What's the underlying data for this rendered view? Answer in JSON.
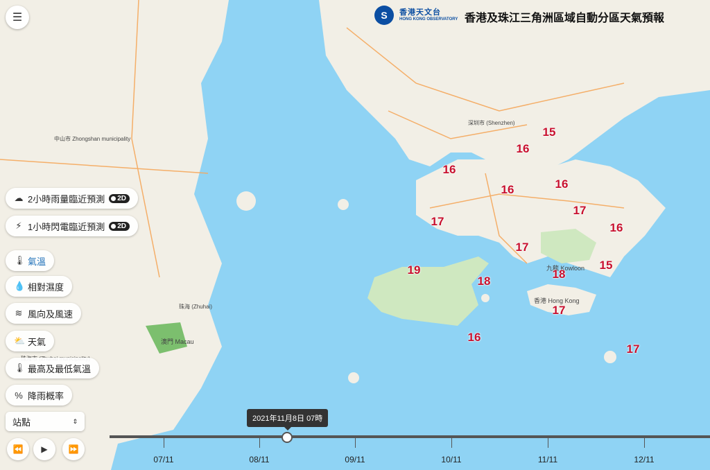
{
  "header": {
    "logo_cn": "香港天文台",
    "logo_en": "HONG KONG OBSERVATORY",
    "title": "香港及珠江三角洲區域自動分區天氣預報"
  },
  "menu_icon": "menu-icon",
  "panel": {
    "rain_nowcast": {
      "label": "2小時雨量臨近預測",
      "badge": "2D"
    },
    "lightning_nowcast": {
      "label": "1小時閃電臨近預測",
      "badge": "2D"
    },
    "temperature": {
      "label": "氣溫"
    },
    "humidity": {
      "label": "相對濕度"
    },
    "wind": {
      "label": "風向及風速"
    },
    "weather": {
      "label": "天氣"
    },
    "max_min_temp": {
      "label": "最高及最低氣溫"
    },
    "rain_prob": {
      "label": "降雨概率"
    },
    "station_select": {
      "value": "站點"
    }
  },
  "map_labels": {
    "zhongshan": "中山市 Zhongshan municipality",
    "shenzhen": "深圳市 (Shenzhen)",
    "macau": "澳門 Macau",
    "zhuhai": "珠海市 (Zhuhai municipality)",
    "kowloon": "九龍 Kowloon",
    "hongkong": "香港 Hong Kong",
    "zhuhai_city": "珠海 (Zhuhai)"
  },
  "temperatures": [
    {
      "v": "15"
    },
    {
      "v": "16"
    },
    {
      "v": "16"
    },
    {
      "v": "16"
    },
    {
      "v": "16"
    },
    {
      "v": "17"
    },
    {
      "v": "17"
    },
    {
      "v": "16"
    },
    {
      "v": "17"
    },
    {
      "v": "15"
    },
    {
      "v": "18"
    },
    {
      "v": "19"
    },
    {
      "v": "18"
    },
    {
      "v": "17"
    },
    {
      "v": "16"
    },
    {
      "v": "17"
    }
  ],
  "timeline": {
    "current": "2021年11月8日 07時",
    "dates": [
      "07/11",
      "08/11",
      "09/11",
      "10/11",
      "11/11",
      "12/11"
    ]
  },
  "colors": {
    "sea": "#8fd3f4",
    "land": "#f2efe6",
    "green": "#cfe8c0",
    "temp": "#c8102e"
  }
}
